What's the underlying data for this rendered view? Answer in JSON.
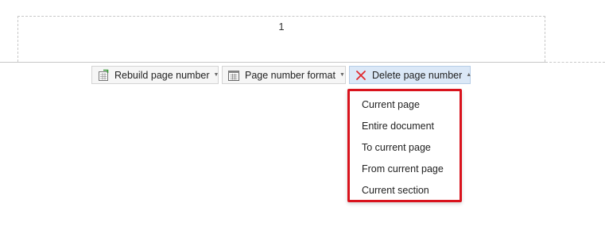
{
  "header": {
    "page_number": "1"
  },
  "toolbar": {
    "rebuild_label": "Rebuild page number",
    "format_label": "Page number format",
    "delete_label": "Delete page number"
  },
  "delete_menu": {
    "items": [
      {
        "label": "Current page"
      },
      {
        "label": "Entire document"
      },
      {
        "label": "To current page"
      },
      {
        "label": "From current page"
      },
      {
        "label": "Current section"
      }
    ]
  },
  "colors": {
    "highlight_border": "#d9131d",
    "active_button_bg": "#dbe8f7",
    "delete_icon": "#e0282e"
  },
  "icons": {
    "rebuild": "rebuild-page-number-icon",
    "format": "page-number-format-icon",
    "delete": "delete-x-icon"
  }
}
